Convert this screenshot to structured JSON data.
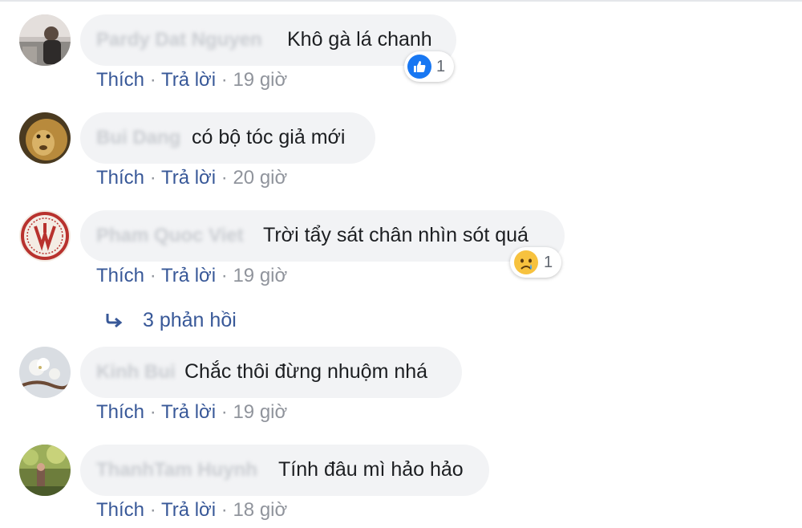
{
  "comments": [
    {
      "author": "Pardy Dat Nguyen",
      "text": "Khô gà lá chanh",
      "like_label": "Thích",
      "reply_label": "Trả lời",
      "time": "19 giờ",
      "reaction": {
        "icon": "like-icon",
        "count": "1"
      }
    },
    {
      "author": "Bui Dang",
      "text": "có bộ tóc giả mới",
      "like_label": "Thích",
      "reply_label": "Trả lời",
      "time": "20 giờ"
    },
    {
      "author": "Pham Quoc Viet",
      "text": "Trời tẩy sát chân nhìn sót quá",
      "like_label": "Thích",
      "reply_label": "Trả lời",
      "time": "19 giờ",
      "reaction": {
        "icon": "sad-icon",
        "count": "1"
      }
    },
    {
      "author": "Kinh Bui",
      "text": "Chắc thôi đừng nhuộm nhá",
      "like_label": "Thích",
      "reply_label": "Trả lời",
      "time": "19 giờ"
    },
    {
      "author": "ThanhTam Huynh",
      "text": "Tính đâu mì hảo hảo",
      "like_label": "Thích",
      "reply_label": "Trả lời",
      "time": "18 giờ"
    }
  ],
  "replies_link": {
    "label": "3 phản hồi",
    "icon": "reply-arrow-icon"
  },
  "separator": " · ",
  "colors": {
    "link": "#385898",
    "bubble": "#f2f3f5",
    "meta": "#90949c",
    "like_blue": "#1877f2"
  }
}
